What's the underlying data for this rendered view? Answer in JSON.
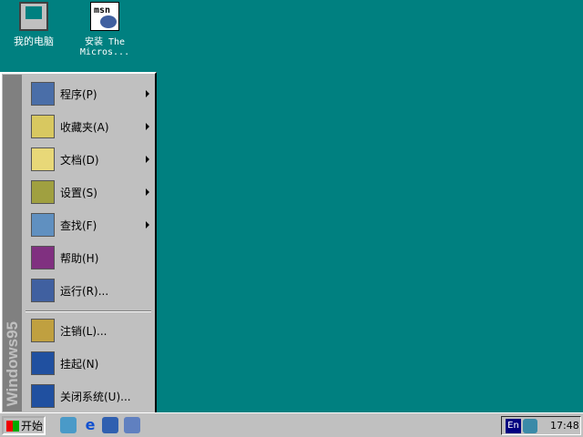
{
  "desktop": {
    "icons": [
      {
        "label": "我的电脑"
      },
      {
        "label": "安装 The Micros..."
      }
    ]
  },
  "start_menu": {
    "banner": "Windows95",
    "items": [
      {
        "label": "程序(P)",
        "submenu": true,
        "color": "#4a6ea8"
      },
      {
        "label": "收藏夹(A)",
        "submenu": true,
        "color": "#d8c860"
      },
      {
        "label": "文档(D)",
        "submenu": true,
        "color": "#e8d878"
      },
      {
        "label": "设置(S)",
        "submenu": true,
        "color": "#a0a040"
      },
      {
        "label": "查找(F)",
        "submenu": true,
        "color": "#6090c0"
      },
      {
        "label": "帮助(H)",
        "submenu": false,
        "color": "#803080"
      },
      {
        "label": "运行(R)...",
        "submenu": false,
        "color": "#4060a0"
      },
      {
        "label": "注销(L)...",
        "submenu": false,
        "color": "#c0a040"
      },
      {
        "label": "挂起(N)",
        "submenu": false,
        "color": "#2050a0"
      },
      {
        "label": "关闭系统(U)...",
        "submenu": false,
        "color": "#2050a0"
      }
    ]
  },
  "taskbar": {
    "start_label": "开始",
    "tray": {
      "lang": "En",
      "clock": "17:48"
    }
  }
}
